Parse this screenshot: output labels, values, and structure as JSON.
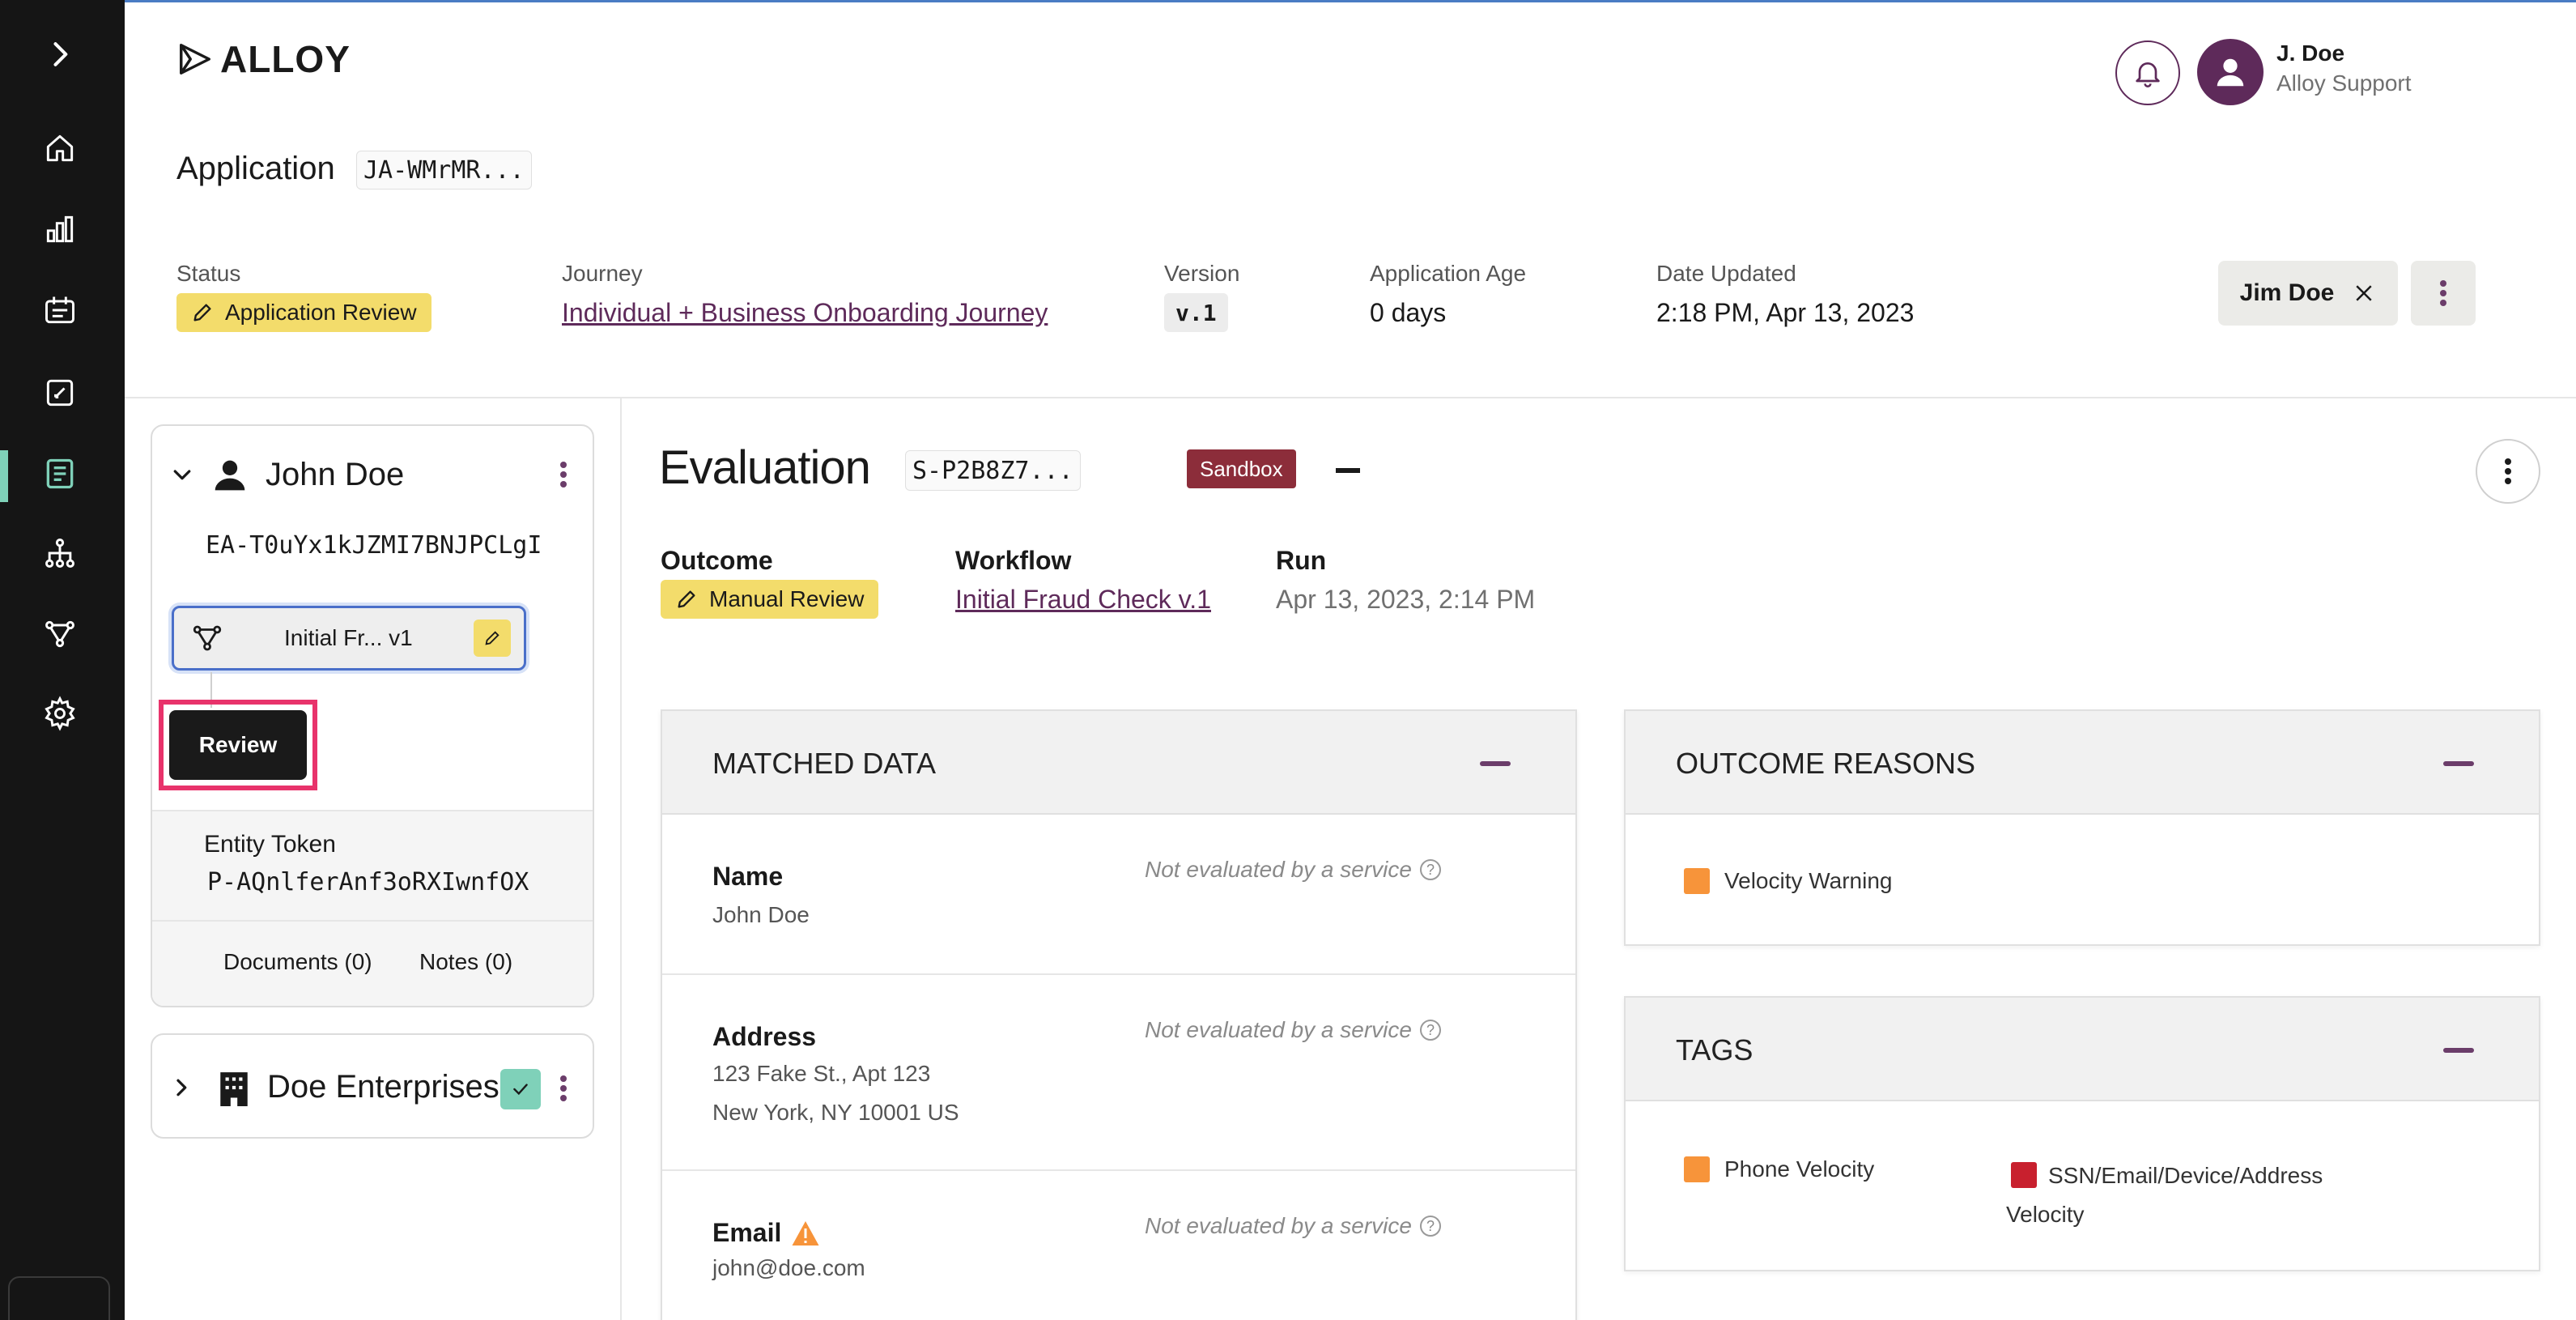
{
  "brand": {
    "name": "ALLOY"
  },
  "user": {
    "name": "J. Doe",
    "org": "Alloy Support"
  },
  "application": {
    "title": "Application",
    "id": "JA-WMrMR...",
    "status_label": "Status",
    "status": "Application Review",
    "journey_label": "Journey",
    "journey": "Individual + Business Onboarding Journey",
    "version_label": "Version",
    "version": "v.1",
    "age_label": "Application Age",
    "age": "0 days",
    "updated_label": "Date Updated",
    "updated": "2:18 PM, Apr 13, 2023",
    "assignee": "Jim Doe"
  },
  "entity": {
    "name": "John Doe",
    "id": "EA-T0uYx1kJZMI7BNJPCLgI",
    "workflow_chip": "Initial Fr... v1",
    "review_button": "Review",
    "token_label": "Entity Token",
    "token": "P-AQnlferAnf3oRXIwnfOX",
    "documents": "Documents (0)",
    "notes": "Notes (0)"
  },
  "business": {
    "name": "Doe Enterprises"
  },
  "evaluation": {
    "title": "Evaluation",
    "id": "S-P2B8Z7...",
    "env": "Sandbox",
    "outcome_label": "Outcome",
    "outcome": "Manual Review",
    "workflow_label": "Workflow",
    "workflow": "Initial Fraud Check v.1",
    "run_label": "Run",
    "run": "Apr 13, 2023, 2:14 PM"
  },
  "matched_data": {
    "title": "MATCHED DATA",
    "note": "Not evaluated by a service",
    "rows": [
      {
        "field": "Name",
        "lines": [
          "John Doe"
        ]
      },
      {
        "field": "Address",
        "lines": [
          "123 Fake St., Apt 123",
          "New York, NY 10001 US"
        ]
      },
      {
        "field": "Email",
        "lines": [
          "john@doe.com"
        ]
      }
    ]
  },
  "outcome_reasons": {
    "title": "OUTCOME REASONS",
    "items": [
      {
        "label": "Velocity Warning",
        "color": "#f7943a"
      }
    ]
  },
  "tags": {
    "title": "TAGS",
    "items": [
      {
        "label": "Phone Velocity",
        "color": "#f7943a"
      },
      {
        "label": "SSN/Email/Device/Address",
        "label2": "Velocity",
        "color": "#c8202e"
      }
    ]
  },
  "colors": {
    "accent": "#5e2a5a",
    "highlight": "#e8336b",
    "badge": "#f3dc6b",
    "sandbox": "#8c2d3a"
  }
}
